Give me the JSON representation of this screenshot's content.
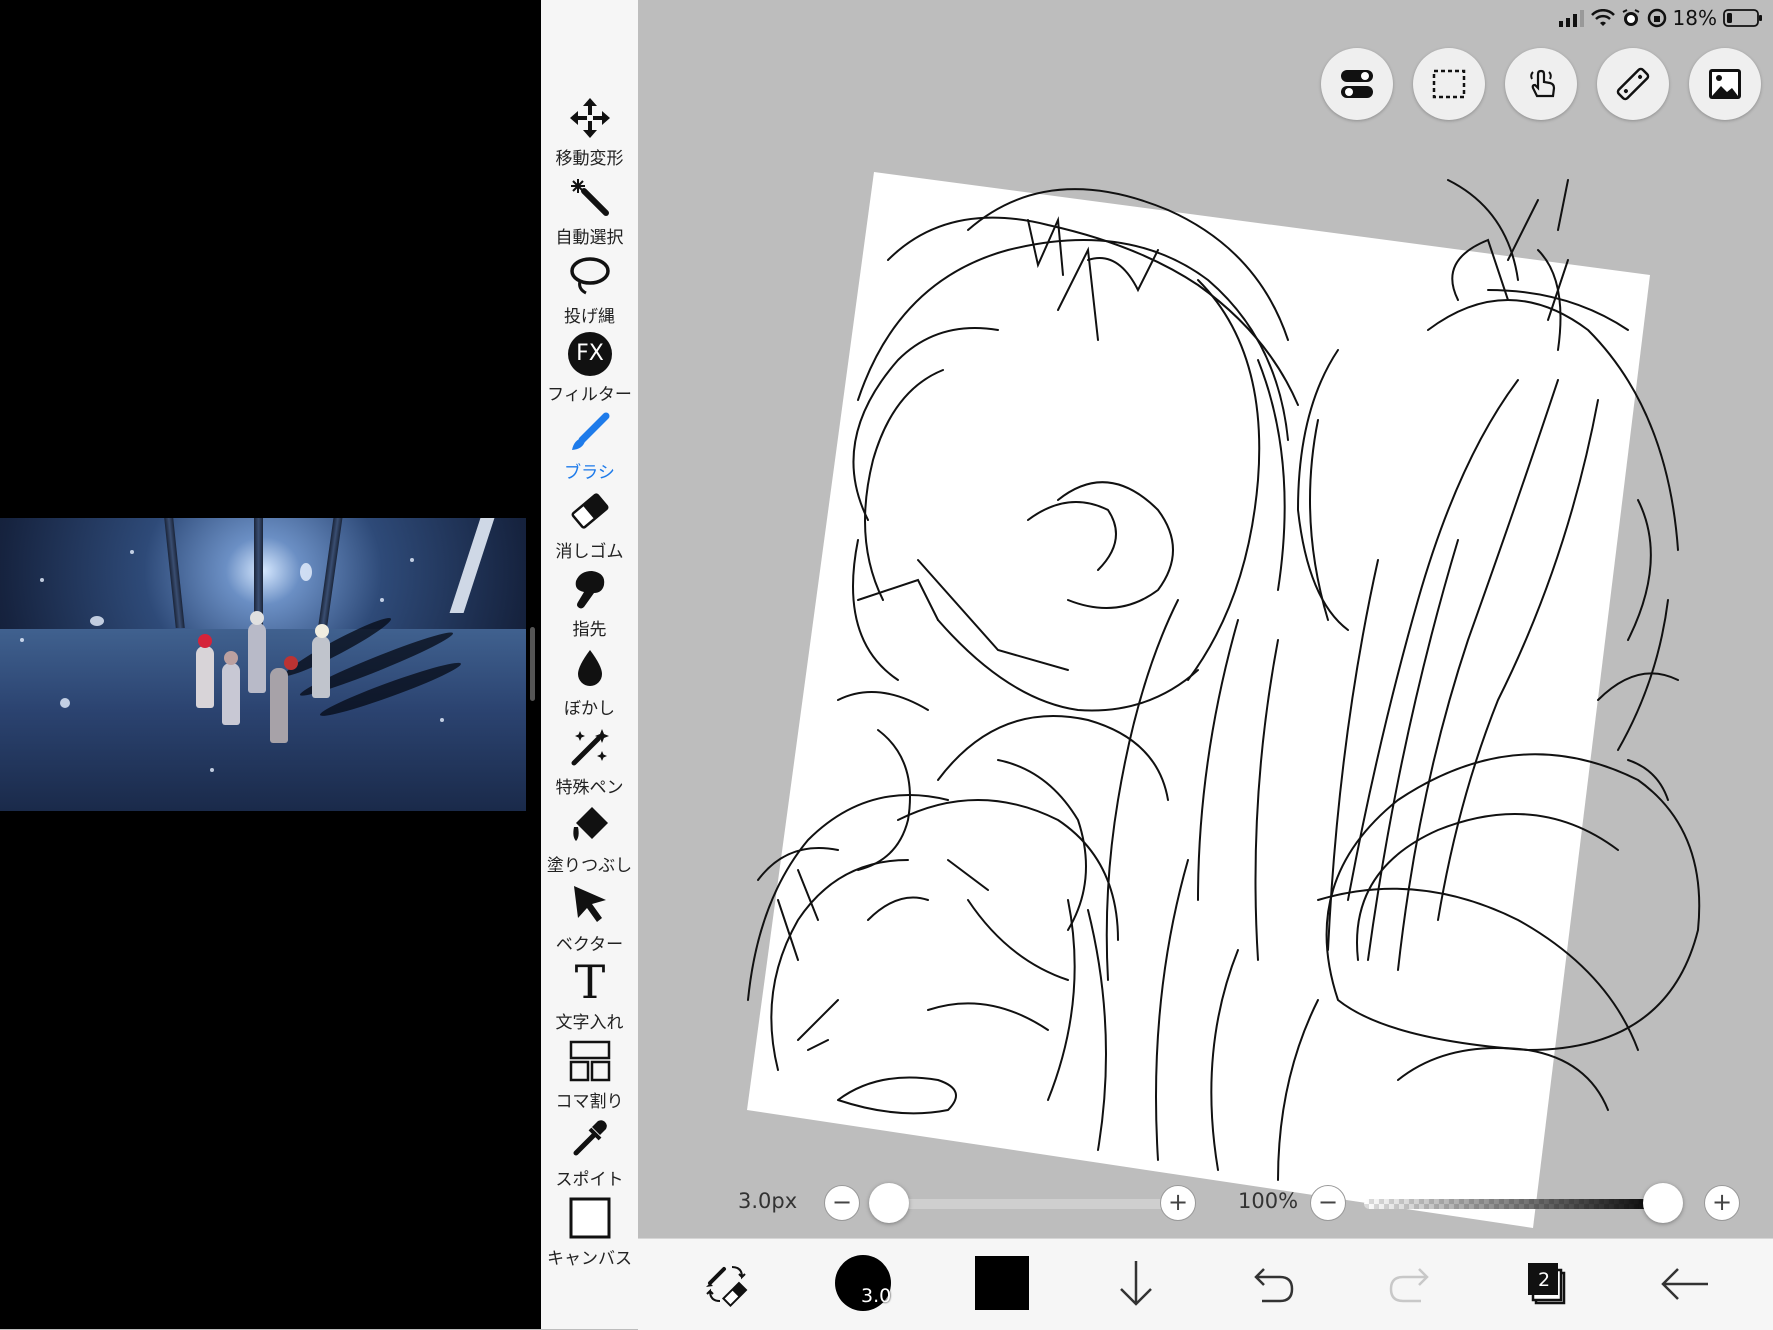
{
  "status_bar": {
    "battery": "18%"
  },
  "toolbar": {
    "items": [
      {
        "label": "移動変形",
        "icon": "move-transform-icon"
      },
      {
        "label": "自動選択",
        "icon": "magic-wand-icon"
      },
      {
        "label": "投げ縄",
        "icon": "lasso-icon"
      },
      {
        "label": "フィルター",
        "icon": "fx-filter-icon",
        "glyph": "FX"
      },
      {
        "label": "ブラシ",
        "icon": "brush-icon",
        "active": true
      },
      {
        "label": "消しゴム",
        "icon": "eraser-icon"
      },
      {
        "label": "指先",
        "icon": "finger-smudge-icon"
      },
      {
        "label": "ぼかし",
        "icon": "blur-drop-icon"
      },
      {
        "label": "特殊ペン",
        "icon": "special-pen-icon"
      },
      {
        "label": "塗りつぶし",
        "icon": "fill-bucket-icon"
      },
      {
        "label": "ベクター",
        "icon": "vector-cursor-icon"
      },
      {
        "label": "文字入れ",
        "icon": "text-icon",
        "glyph": "T"
      },
      {
        "label": "コマ割り",
        "icon": "frame-divider-icon"
      },
      {
        "label": "スポイト",
        "icon": "eyedropper-icon"
      },
      {
        "label": "キャンバス",
        "icon": "canvas-icon"
      }
    ],
    "active_color": "#1e7bea"
  },
  "top_buttons": [
    "toggle-settings-icon",
    "selection-rect-icon",
    "touch-gesture-icon",
    "ruler-icon",
    "image-icon"
  ],
  "sliders": {
    "brush_size": "3.0px",
    "brush_size_fraction": 0.0,
    "opacity": "100%",
    "opacity_fraction": 1.0,
    "minus": "−",
    "plus": "+"
  },
  "bottom_bar": {
    "brush_size_badge": "3.0",
    "layer_count": "2",
    "current_color": "#000000"
  }
}
